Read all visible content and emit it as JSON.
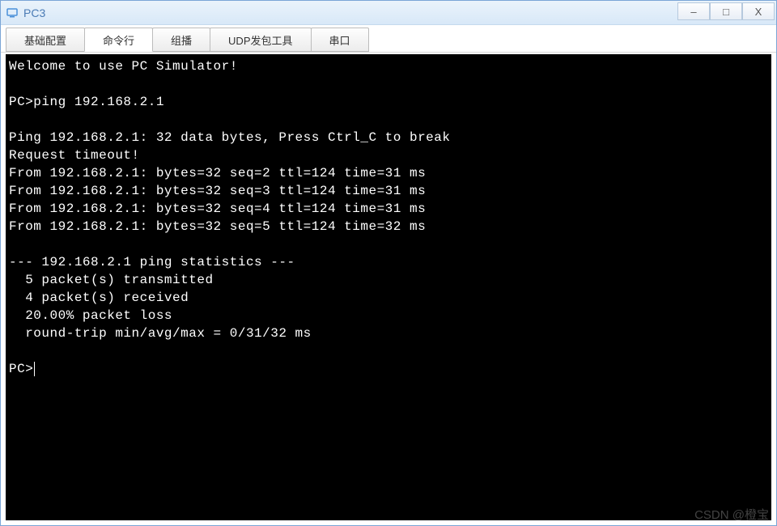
{
  "window": {
    "title": "PC3",
    "icon_name": "pc-icon",
    "controls": {
      "minimize": "–",
      "maximize": "□",
      "close": "X"
    }
  },
  "tabs": [
    {
      "label": "基础配置",
      "active": false
    },
    {
      "label": "命令行",
      "active": true
    },
    {
      "label": "组播",
      "active": false
    },
    {
      "label": "UDP发包工具",
      "active": false
    },
    {
      "label": "串口",
      "active": false
    }
  ],
  "terminal": {
    "lines": [
      "Welcome to use PC Simulator!",
      "",
      "PC>ping 192.168.2.1",
      "",
      "Ping 192.168.2.1: 32 data bytes, Press Ctrl_C to break",
      "Request timeout!",
      "From 192.168.2.1: bytes=32 seq=2 ttl=124 time=31 ms",
      "From 192.168.2.1: bytes=32 seq=3 ttl=124 time=31 ms",
      "From 192.168.2.1: bytes=32 seq=4 ttl=124 time=31 ms",
      "From 192.168.2.1: bytes=32 seq=5 ttl=124 time=32 ms",
      "",
      "--- 192.168.2.1 ping statistics ---",
      "  5 packet(s) transmitted",
      "  4 packet(s) received",
      "  20.00% packet loss",
      "  round-trip min/avg/max = 0/31/32 ms",
      "",
      "PC>"
    ],
    "prompt_has_cursor": true
  },
  "watermark": "CSDN @橙宝",
  "colors": {
    "title_text": "#4a7bb5",
    "terminal_bg": "#000000",
    "terminal_fg": "#ffffff"
  }
}
